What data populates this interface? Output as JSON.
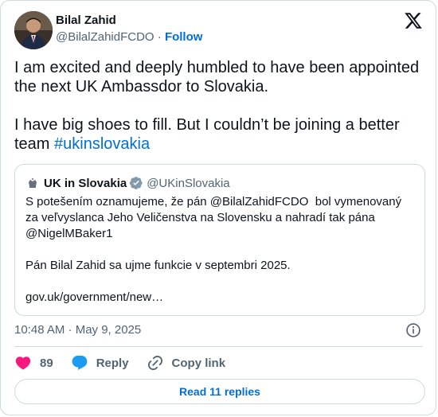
{
  "author": {
    "display_name": "Bilal Zahid",
    "handle": "@BilalZahidFCDO",
    "separator": "·",
    "follow_label": "Follow"
  },
  "tweet": {
    "text_main": "I am excited and deeply humbled to have been appointed the next UK Ambassdor to Slovakia.\n\nI have big shoes to fill. But I couldn’t be joining a better team ",
    "hashtag": "#ukinslovakia"
  },
  "quote": {
    "name": "UK in Slovakia",
    "handle": "@UKinSlovakia",
    "text": "S potešením oznamujeme, že pán @BilalZahidFCDO  bol vymenovaný za veľvyslanca Jeho Veličenstva na Slovensku a nahradí tak pána @NigelMBaker1\n\nPán Bilal Zahid sa ujme funkcie v septembri 2025.\n\ngov.uk/government/new…"
  },
  "meta": {
    "timestamp": "10:48 AM · May 9, 2025"
  },
  "actions": {
    "likes": "89",
    "reply_label": "Reply",
    "copy_link_label": "Copy link"
  },
  "footer": {
    "read_replies_label": "Read 11 replies"
  },
  "colors": {
    "link": "#006fd6",
    "like": "#f91880",
    "reply_bubble": "#1d9bf0",
    "muted": "#536471",
    "border": "#cfd9de"
  },
  "icons": {
    "platform_logo": "x-logo-icon",
    "info": "info-icon",
    "like": "heart-icon",
    "reply": "speech-bubble-icon",
    "copy_link": "link-icon",
    "verified": "verified-badge-icon"
  }
}
